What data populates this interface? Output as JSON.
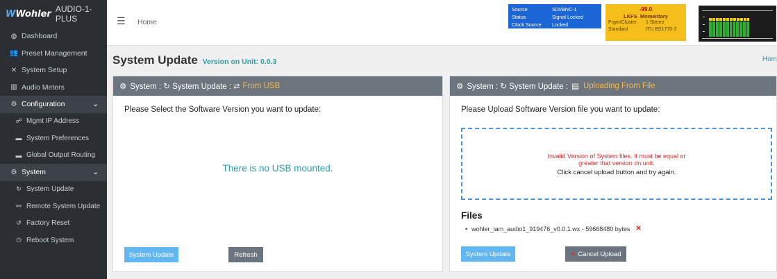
{
  "brand": {
    "logo": "Wohler",
    "model": "AUDIO-1-PLUS"
  },
  "sidebar": {
    "items": [
      {
        "label": "Dashboard",
        "icon": "dashboard-icon"
      },
      {
        "label": "Preset Management",
        "icon": "users-icon"
      },
      {
        "label": "System Setup",
        "icon": "tools-icon"
      },
      {
        "label": "Audio Meters",
        "icon": "meter-icon"
      },
      {
        "label": "Configuration",
        "icon": "gear-icon"
      },
      {
        "label": "Mgmt IP Address",
        "icon": "network-icon"
      },
      {
        "label": "System Preferences",
        "icon": "prefs-icon"
      },
      {
        "label": "Global Output Routing",
        "icon": "routing-icon"
      },
      {
        "label": "System",
        "icon": "gears-icon"
      },
      {
        "label": "System Update",
        "icon": "sync-icon"
      },
      {
        "label": "Remote System Update",
        "icon": "remote-icon"
      },
      {
        "label": "Factory Reset",
        "icon": "undo-icon"
      },
      {
        "label": "Reboot System",
        "icon": "power-icon"
      }
    ]
  },
  "topbar": {
    "breadcrumb": "Home",
    "status": {
      "source_label": "Source",
      "source_value": "SDI/BNC-1",
      "status_label": "Status",
      "status_value": "Signal Locked",
      "clock_label": "Clock Source",
      "clock_value": "Locked"
    },
    "loudness": {
      "value": "-99.0",
      "unit": "LKFS",
      "mode": "Momentary",
      "prgm_label": "Prgm/Cluster",
      "prgm_value": "1  Stereo",
      "std_label": "Standard",
      "std_value": "ITU BS1770-3"
    }
  },
  "page": {
    "title": "System Update",
    "version": "Version on Unit: 0.0.3",
    "breadcrumb_right": "Hom"
  },
  "usb_panel": {
    "header_prefix": "System : ↻ System Update : ⮂",
    "header_highlight": "From USB",
    "prompt": "Please Select the Software Version you want to update:",
    "empty_message": "There is no USB mounted.",
    "update_button": "System Update",
    "refresh_button": "Refresh"
  },
  "file_panel": {
    "header_prefix": "System : ↻ System Update :",
    "header_highlight": "Uploading From File",
    "prompt": "Please Upload Software Version file you want to update:",
    "error_line1": "Invalid Version of System files. It must be equal or",
    "error_line2": "greater that version on unit.",
    "instruction": "Click cancel upload button and try again.",
    "files_heading": "Files",
    "file_name": "wohler_iam_audio1_919476_v0.0.1.wx - 59668480 bytes",
    "update_button": "System Update",
    "cancel_button": "Cancel Upload"
  },
  "colors": {
    "sidebar_bg": "#2b2f33",
    "accent_teal": "#2a9aa8",
    "status_blue": "#1a66d6",
    "status_yellow": "#f4bf1a",
    "button_blue": "#62b6f2",
    "header_gray": "#6c757d",
    "error_red": "#d32f2f"
  }
}
